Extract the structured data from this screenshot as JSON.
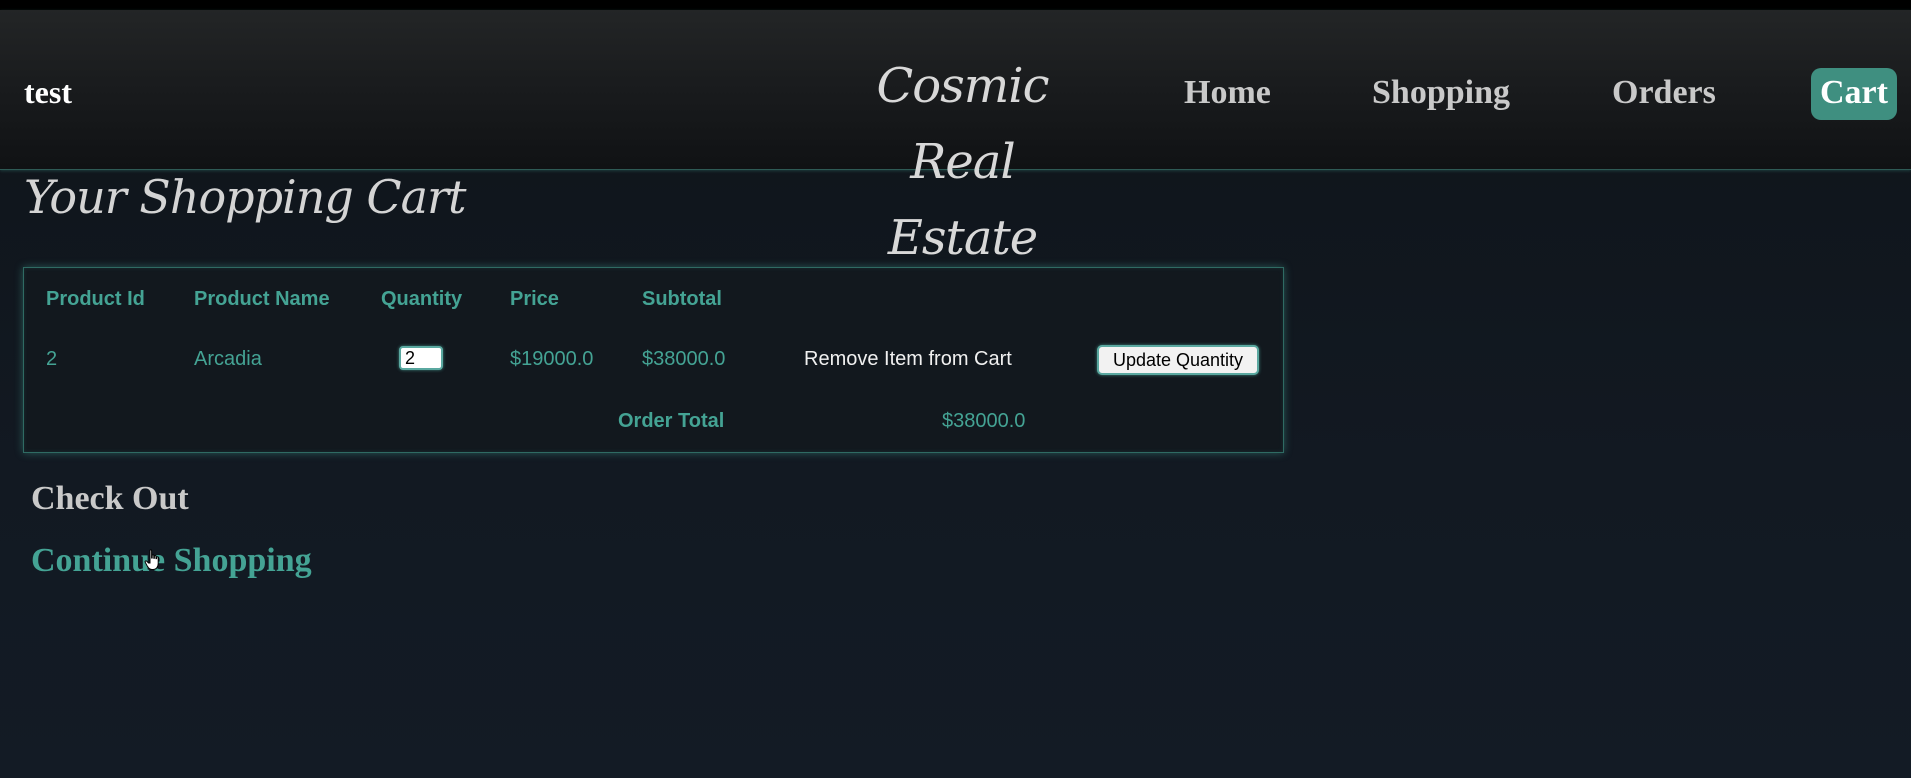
{
  "navbar": {
    "user": "test",
    "site_title": "Cosmic Real Estate",
    "links": {
      "home": "Home",
      "shopping": "Shopping",
      "orders": "Orders",
      "cart": "Cart"
    }
  },
  "page": {
    "heading": "Your Shopping Cart"
  },
  "cart": {
    "columns": {
      "product_id": "Product Id",
      "product_name": "Product Name",
      "quantity": "Quantity",
      "price": "Price",
      "subtotal": "Subtotal"
    },
    "items": [
      {
        "product_id": "2",
        "product_name": "Arcadia",
        "quantity": "2",
        "price": "$19000.0",
        "subtotal": "$38000.0",
        "remove_label": "Remove Item from Cart",
        "update_label": "Update Quantity"
      }
    ],
    "order_total_label": "Order Total",
    "order_total_value": "$38000.0"
  },
  "actions": {
    "checkout": "Check Out",
    "continue_shopping": "Continue Shopping"
  },
  "colors": {
    "accent": "#44a394",
    "cart_active_bg": "#3f8f80",
    "background": "#121922"
  },
  "icons": {
    "cursor": "hand-pointer-icon"
  }
}
